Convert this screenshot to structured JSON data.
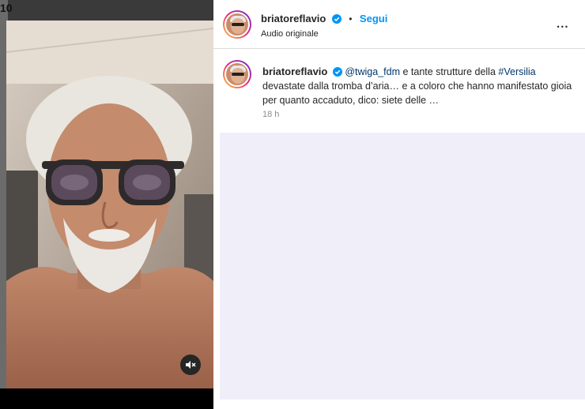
{
  "backdrop": {
    "fragment_text": "10"
  },
  "post": {
    "username": "briatoreflavio",
    "follow_label": "Segui",
    "separator": "•",
    "audio_label": "Audio originale",
    "more_label": "•••",
    "caption": {
      "username": "briatoreflavio",
      "mention": "@twiga_fdm",
      "text_part1": " e tante strutture della ",
      "hashtag": "#Versilia",
      "text_part2": " devastate dalla tromba d’aria… e a coloro che hanno manifestato gioia per quanto accaduto, dico: siete delle …"
    },
    "timestamp": "18 h"
  },
  "video": {
    "mute_icon": "speaker-muted-icon"
  },
  "colors": {
    "accent": "#0095f6",
    "verified": "#0095f6",
    "link": "#00376b"
  }
}
